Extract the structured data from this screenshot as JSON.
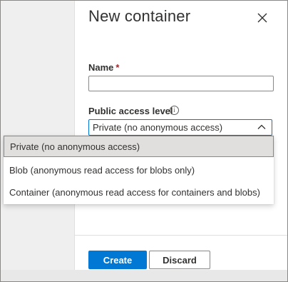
{
  "panel": {
    "title": "New container",
    "close_icon": "close-icon"
  },
  "form": {
    "name_label": "Name",
    "name_required": "*",
    "name_value": "",
    "access_label": "Public access level",
    "info_icon": "info-icon",
    "access_selected": "Private (no anonymous access)"
  },
  "dropdown": {
    "options": [
      {
        "label": "Private (no anonymous access)",
        "selected": true
      },
      {
        "label": "Blob (anonymous read access for blobs only)",
        "selected": false
      },
      {
        "label": "Container (anonymous read access for containers and blobs)",
        "selected": false
      }
    ]
  },
  "footer": {
    "create_label": "Create",
    "discard_label": "Discard"
  },
  "colors": {
    "accent": "#0078d4",
    "required": "#a4262c",
    "selected_bg": "#e1dfdd"
  }
}
